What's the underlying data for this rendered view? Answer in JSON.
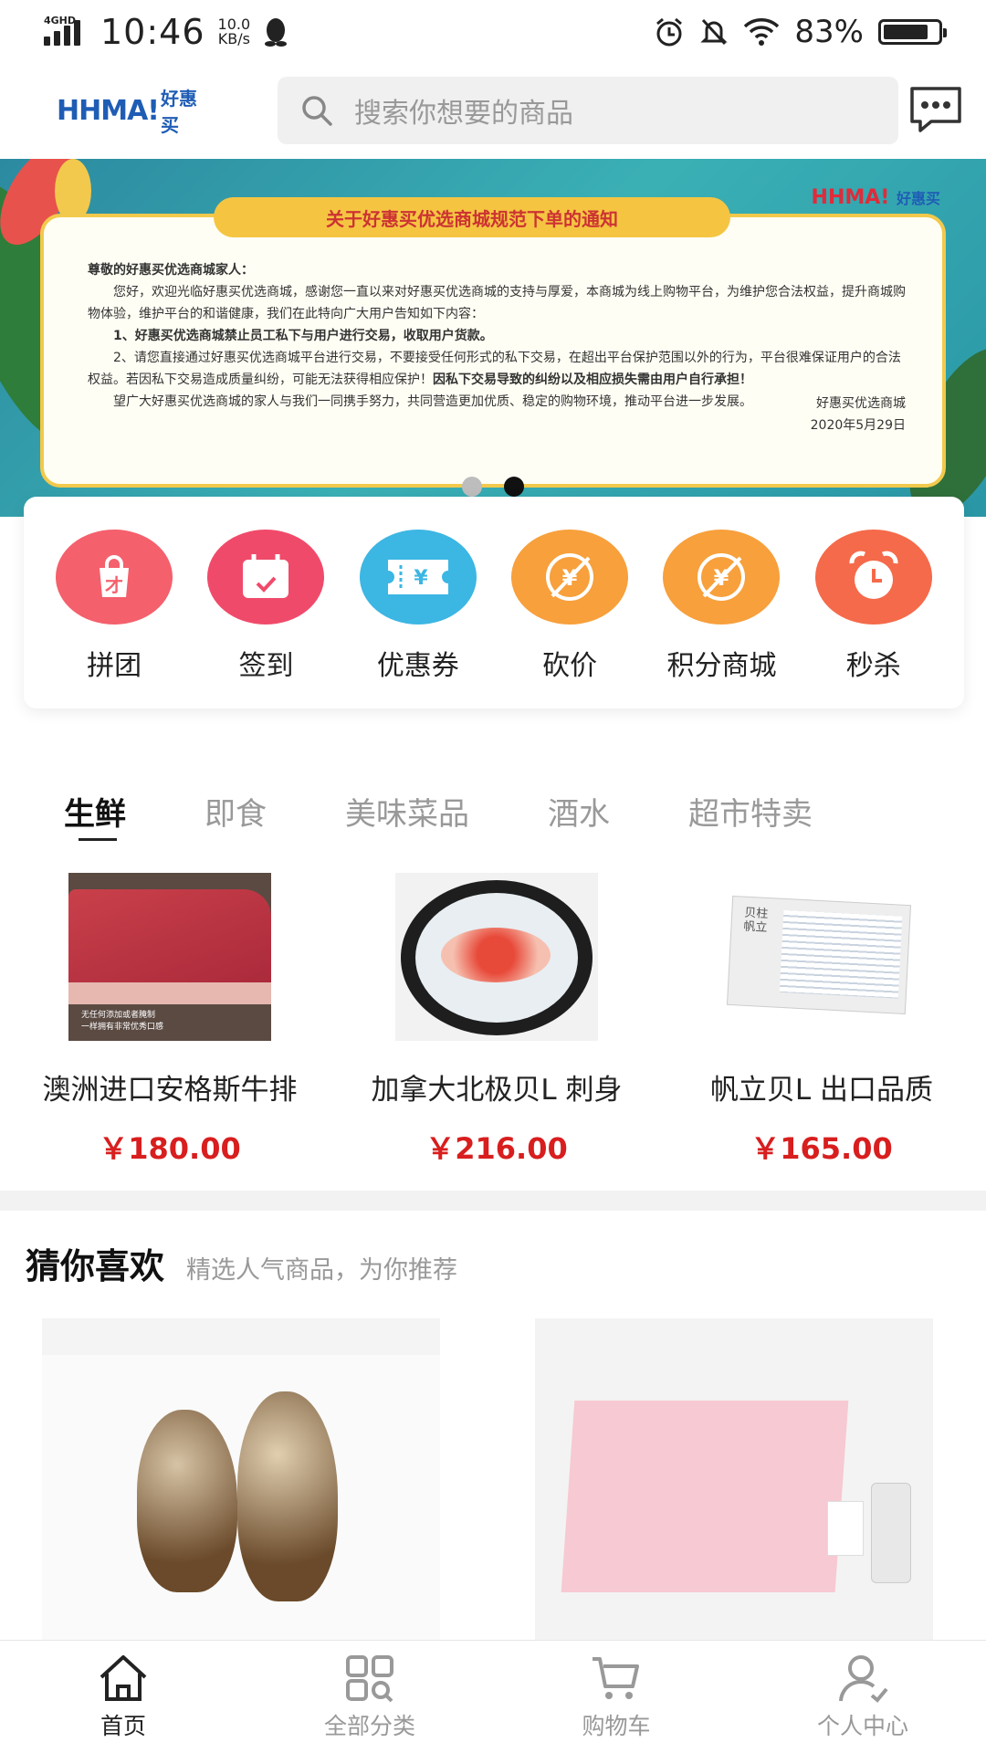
{
  "status_bar": {
    "network": "4GHD",
    "time": "10:46",
    "speed_value": "10.0",
    "speed_unit": "KB/s",
    "battery": "83%",
    "battery_level": 0.83
  },
  "header": {
    "logo_text_1": "HHMA!",
    "logo_text_2": "好惠买",
    "search_placeholder": "搜索你想要的商品"
  },
  "banner": {
    "notice_title": "关于好惠买优选商城规范下单的通知",
    "logo_text_1": "HHMA!",
    "logo_text_2": "好惠买",
    "greeting": "尊敬的好惠买优选商城家人：",
    "para1": "您好，欢迎光临好惠买优选商城，感谢您一直以来对好惠买优选商城的支持与厚爱，本商城为线上购物平台，为维护您合法权益，提升商城购物体验，维护平台的和谐健康，我们在此特向广大用户告知如下内容：",
    "point1": "1、好惠买优选商城禁止员工私下与用户进行交易，收取用户货款。",
    "point2a": "2、请您直接通过好惠买优选商城平台进行交易，不要接受任何形式的私下交易，在超出平台保护范围以外的行为，平台很难保证用户的合法权益。若因私下交易造成质量纠纷，可能无法获得相应保护！",
    "point2b": "因私下交易导致的纠纷以及相应损失需由用户自行承担！",
    "para3": "望广大好惠买优选商城的家人与我们一同携手努力，共同营造更加优质、稳定的购物环境，推动平台进一步发展。",
    "sign": "好惠买优选商城",
    "date": "2020年5月29日"
  },
  "quick_menu": [
    {
      "label": "拼团",
      "icon": "shopping-bag-icon",
      "color": "#f4606c"
    },
    {
      "label": "签到",
      "icon": "calendar-check-icon",
      "color": "#f04a6a"
    },
    {
      "label": "优惠券",
      "icon": "coupon-ticket-icon",
      "color": "#3cb6e3"
    },
    {
      "label": "砍价",
      "icon": "price-cut-icon",
      "color": "#f7a03c"
    },
    {
      "label": "积分商城",
      "icon": "points-mall-icon",
      "color": "#f7a03c"
    },
    {
      "label": "秒杀",
      "icon": "alarm-clock-icon",
      "color": "#f56a4a"
    }
  ],
  "tabs": [
    {
      "label": "生鲜",
      "active": true
    },
    {
      "label": "即食",
      "active": false
    },
    {
      "label": "美味菜品",
      "active": false
    },
    {
      "label": "酒水",
      "active": false
    },
    {
      "label": "超市特卖",
      "active": false
    }
  ],
  "products": [
    {
      "name": "澳洲进口安格斯牛排",
      "price": "￥180.00",
      "img_caption_1": "无任何添加或者腌制",
      "img_caption_2": "一样拥有非常优秀口感"
    },
    {
      "name": "加拿大北极贝L 刺身",
      "price": "￥216.00"
    },
    {
      "name": "帆立贝L 出口品质",
      "price": "￥165.00",
      "box_brand": "贝柱 帆立"
    }
  ],
  "guess": {
    "title": "猜你喜欢",
    "subtitle": "精选人气商品，为你推荐"
  },
  "bottom_nav": [
    {
      "label": "首页",
      "icon": "home-icon",
      "active": true
    },
    {
      "label": "全部分类",
      "icon": "category-grid-icon",
      "active": false
    },
    {
      "label": "购物车",
      "icon": "cart-icon",
      "active": false
    },
    {
      "label": "个人中心",
      "icon": "user-icon",
      "active": false
    }
  ],
  "colors": {
    "price_red": "#d81e1e",
    "banner_teal": "#2c8aa0",
    "notice_yellow": "#f5c542"
  }
}
